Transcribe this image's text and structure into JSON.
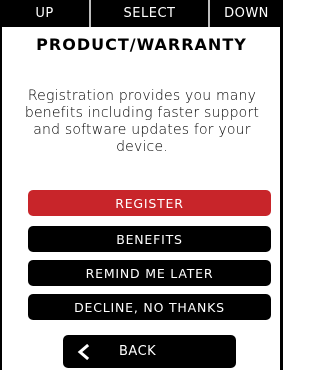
{
  "topbar": {
    "up_label": "UP",
    "select_label": "SELECT",
    "down_label": "DOWN"
  },
  "title": "PRODUCT/WARRANTY",
  "message": {
    "line1": "Registration provides you many",
    "line2": "benefits including faster support",
    "line3": "and software updates for your",
    "line4": "device."
  },
  "actions": {
    "register": "REGISTER",
    "benefits": "BENEFITS",
    "remind": "REMIND ME LATER",
    "decline": "DECLINE, NO THANKS"
  },
  "back": {
    "label": "BACK",
    "icon": "chevron-left-icon"
  },
  "colors": {
    "accent": "#c8252a",
    "button": "#000000",
    "background": "#ffffff"
  }
}
